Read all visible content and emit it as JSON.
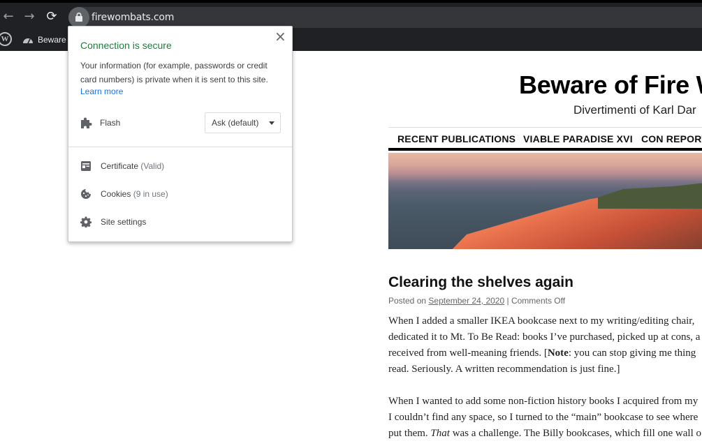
{
  "browser": {
    "nav": {
      "back_glyph": "←",
      "forward_glyph": "→",
      "reload_glyph": "⟳"
    },
    "omnibox": {
      "url": "firewombats.com",
      "icon": "lock-icon"
    },
    "bookmarks": [
      {
        "icon": "wordpress-icon",
        "label": ""
      },
      {
        "icon": "dashboard-icon",
        "label": "Beware"
      }
    ]
  },
  "page_info_popup": {
    "close_glyph": "×",
    "heading": "Connection is secure",
    "description": "Your information (for example, passwords or credit card numbers) is private when it is sent to this site.",
    "learn_more": "Learn more",
    "permissions": [
      {
        "icon": "puzzle-icon",
        "label": "Flash",
        "value": "Ask (default)"
      }
    ],
    "items": [
      {
        "icon": "certificate-icon",
        "label": "Certificate",
        "sub": "(Valid)"
      },
      {
        "icon": "cookie-icon",
        "label": "Cookies",
        "sub": "(9 in use)"
      },
      {
        "icon": "gear-icon",
        "label": "Site settings",
        "sub": ""
      }
    ],
    "heading_color": "#188038",
    "link_color": "#1a73e8"
  },
  "site": {
    "title": "Beware of Fire W",
    "tagline": "Divertimenti of Karl Dar",
    "menu": [
      "RECENT PUBLICATIONS",
      "VIABLE PARADISE XVI",
      "CON REPORT"
    ],
    "post": {
      "title": "Clearing the shelves again",
      "meta_prefix": "Posted on",
      "date": "September 24, 2020",
      "meta_sep": "|",
      "comments": "Comments Off",
      "paragraph1": [
        "When I added a smaller IKEA bookcase next to my writing/editing chair,",
        "dedicated it to Mt. To Be Read: books I’ve purchased, picked up at cons, a",
        "received from well-meaning friends. [",
        "Note",
        ": you can stop giving me thing",
        "read. Seriously. A written recommendation is just fine.]"
      ],
      "paragraph2": [
        "When I wanted to add some non-fiction history books I acquired from my",
        "I couldn’t find any space, so I turned to the “main” bookcase to see where",
        "put them. ",
        "That",
        " was a challenge. The Billy bookcases, which fill one wall o"
      ]
    }
  }
}
